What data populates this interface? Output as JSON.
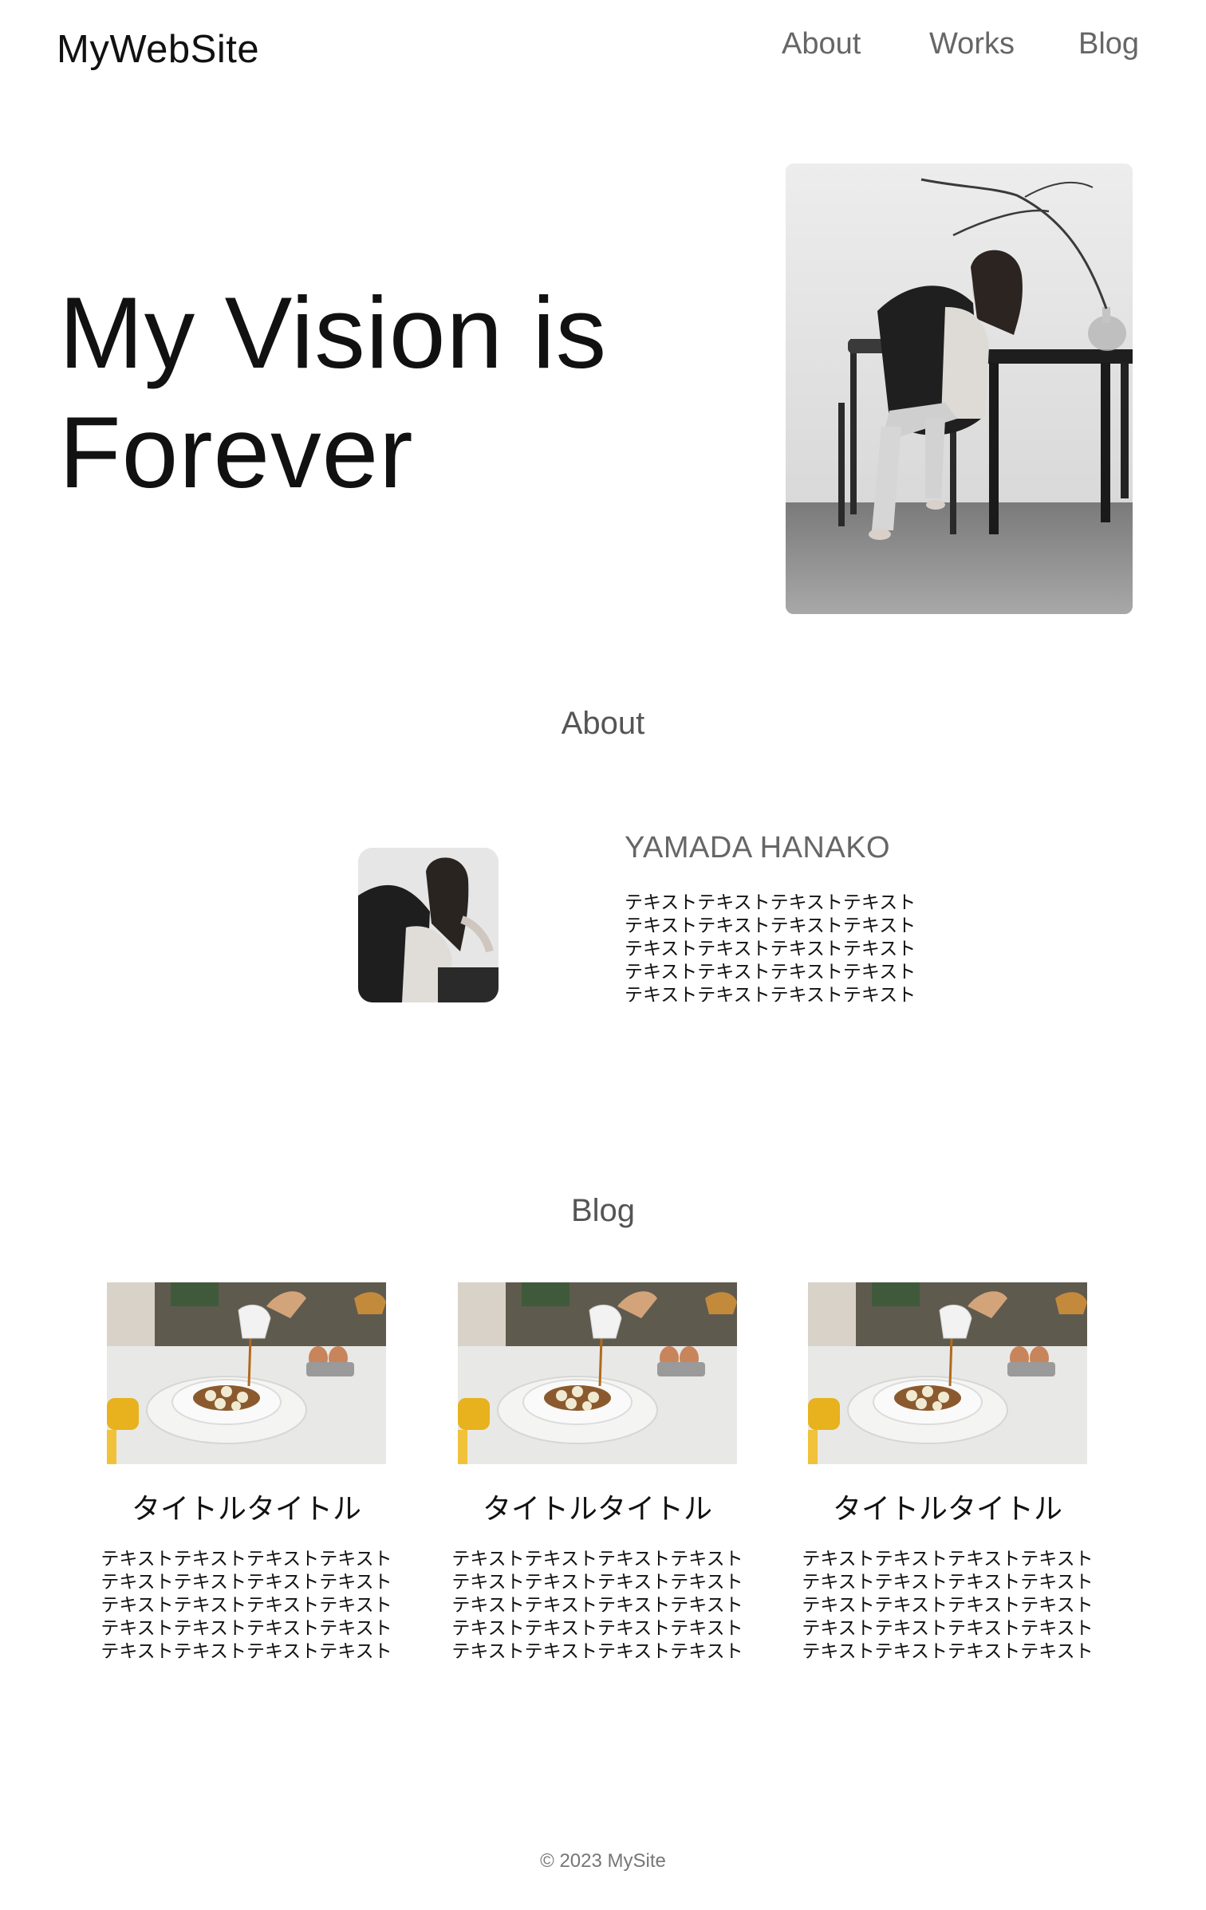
{
  "header": {
    "logo": "MyWebSite",
    "nav": [
      "About",
      "Works",
      "Blog"
    ]
  },
  "hero": {
    "title_lines": [
      "My Vision is",
      "Forever"
    ],
    "image": "woman-sitting-on-chair-photo"
  },
  "about": {
    "heading": "About",
    "name": "YAMADA HANAKO",
    "text_lines": [
      "テキストテキストテキストテキスト",
      "テキストテキストテキストテキスト",
      "テキストテキストテキストテキスト",
      "テキストテキストテキストテキスト",
      "テキストテキストテキストテキスト"
    ],
    "avatar": "profile-photo"
  },
  "blog": {
    "heading": "Blog",
    "posts": [
      {
        "title": "タイトルタイトル",
        "image": "pancake-syrup-photo",
        "text_lines": [
          "テキストテキストテキストテキスト",
          "テキストテキストテキストテキスト",
          "テキストテキストテキストテキスト",
          "テキストテキストテキストテキスト",
          "テキストテキストテキストテキスト"
        ]
      },
      {
        "title": "タイトルタイトル",
        "image": "pancake-syrup-photo",
        "text_lines": [
          "テキストテキストテキストテキスト",
          "テキストテキストテキストテキスト",
          "テキストテキストテキストテキスト",
          "テキストテキストテキストテキスト",
          "テキストテキストテキストテキスト"
        ]
      },
      {
        "title": "タイトルタイトル",
        "image": "pancake-syrup-photo",
        "text_lines": [
          "テキストテキストテキストテキスト",
          "テキストテキストテキストテキスト",
          "テキストテキストテキストテキスト",
          "テキストテキストテキストテキスト",
          "テキストテキストテキストテキスト"
        ]
      }
    ]
  },
  "footer": {
    "copyright": "© 2023 MySite"
  }
}
